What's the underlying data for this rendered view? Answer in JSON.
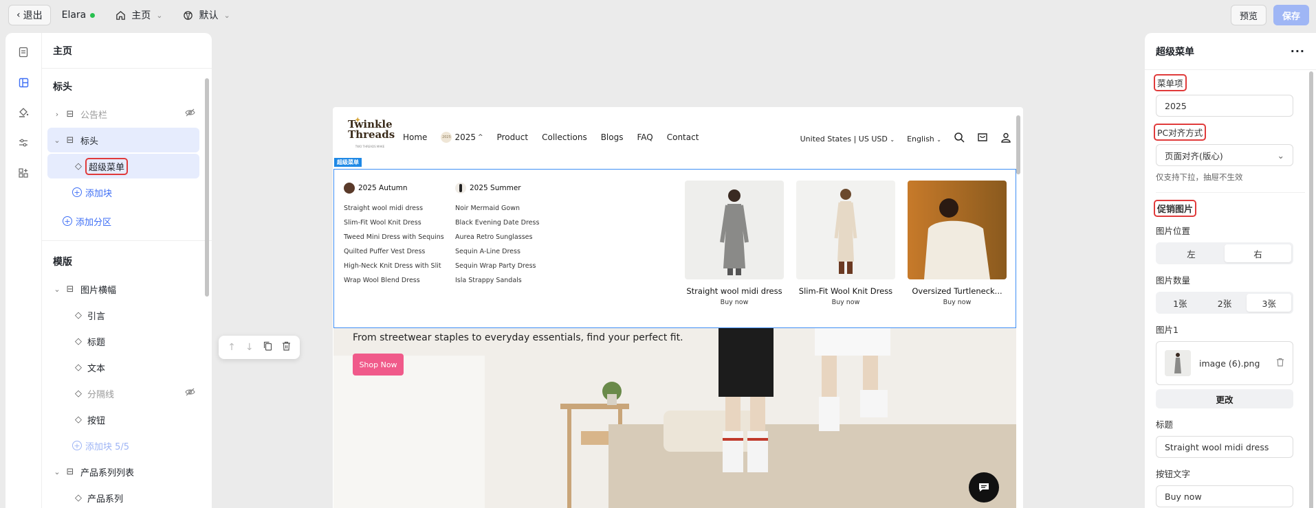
{
  "topbar": {
    "exit_label": "退出",
    "site_name": "Elara",
    "page_select": "主页",
    "theme_select": "默认",
    "preview_label": "预览",
    "save_label": "保存"
  },
  "rail": {
    "icons": [
      "page-icon",
      "layout-icon",
      "paint-bucket-icon",
      "sliders-icon",
      "apps-icon"
    ]
  },
  "tree": {
    "title": "主页",
    "header_section": "标头",
    "announcement": "公告栏",
    "header_node": "标头",
    "super_menu": "超级菜单",
    "add_block": "添加块",
    "add_section": "添加分区",
    "template_section": "模版",
    "image_banner": "图片横幅",
    "quote": "引言",
    "heading": "标题",
    "text": "文本",
    "divider": "分隔线",
    "button": "按钮",
    "add_block_count": "添加块 5/5",
    "collection_list": "产品系列列表",
    "collection_child": "产品系列"
  },
  "storefront": {
    "logo_line1": "Twinkle",
    "logo_line2": "Threads",
    "logo_tag": "TWO THREADS MAKE",
    "nav": [
      "Home",
      "2025",
      "Product",
      "Collections",
      "Blogs",
      "FAQ",
      "Contact"
    ],
    "year_badge": "2025",
    "region": "United States | US USD",
    "language": "English",
    "mega_label": "超级菜单",
    "col1_title": "2025 Autumn",
    "col1_items": [
      "Straight wool midi dress",
      "Slim-Fit Wool Knit Dress",
      "Tweed Mini Dress with Sequins",
      "Quilted Puffer Vest Dress",
      "High-Neck Knit Dress with Slit",
      "Wrap Wool Blend Dress"
    ],
    "col2_title": "2025 Summer",
    "col2_items": [
      "Noir Mermaid Gown",
      "Black Evening Date Dress",
      "Aurea Retro Sunglasses",
      "Sequin A-Line Dress",
      "Sequin Wrap Party Dress",
      "Isla Strappy Sandals"
    ],
    "promos": [
      {
        "title": "Straight wool midi dress",
        "buy": "Buy now"
      },
      {
        "title": "Slim-Fit Wool Knit Dress",
        "buy": "Buy now"
      },
      {
        "title": "Oversized Turtleneck...",
        "buy": "Buy now"
      }
    ],
    "hero_subtitle": "From streetwear staples to everyday essentials, find your perfect fit.",
    "shop_now": "Shop Now"
  },
  "rpanel": {
    "title": "超级菜单",
    "menu_item_label": "菜单项",
    "menu_item_value": "2025",
    "pc_align_label": "PC对齐方式",
    "pc_align_value": "页面对齐(版心)",
    "pc_align_hint": "仅支持下拉，抽屉不生效",
    "promo_images_label": "促销图片",
    "image_position_label": "图片位置",
    "pos_left": "左",
    "pos_right": "右",
    "image_count_label": "图片数量",
    "count_1": "1张",
    "count_2": "2张",
    "count_3": "3张",
    "image1_label": "图片1",
    "image1_file": "image (6).png",
    "change_label": "更改",
    "title_label": "标题",
    "title_value": "Straight wool midi dress",
    "button_text_label": "按钮文字",
    "button_text_value": "Buy now"
  },
  "colors": {
    "accent": "#3d6ef5",
    "save_disabled": "#9fb6f5",
    "selection_bg": "#e6ecfd",
    "highlight_box": "#e03a3a",
    "mega_border": "#3d8ef5",
    "shop_button": "#f05a8a"
  }
}
